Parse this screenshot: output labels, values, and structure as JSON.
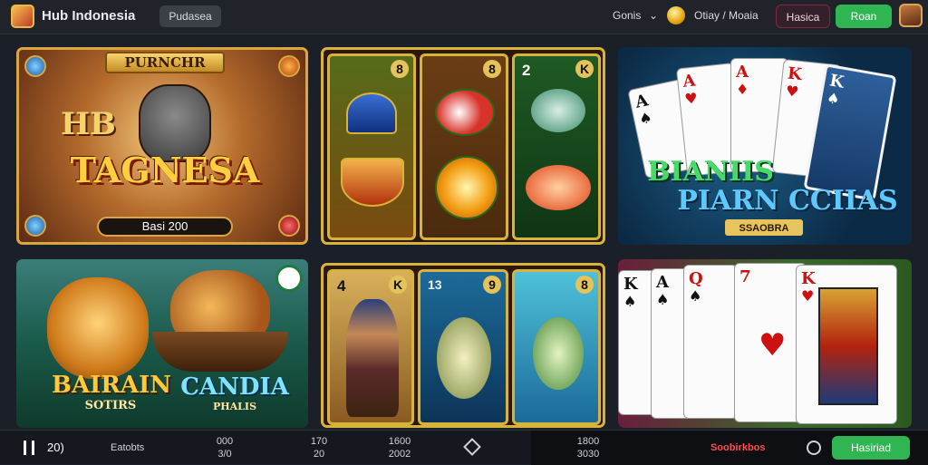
{
  "header": {
    "app_title": "Hub Indonesia",
    "chip_label": "Pudasea",
    "menu_label": "Gonis",
    "menu_chevron": "⌄",
    "user_text": "Otiay / Moaia",
    "secondary_button": "Hasica",
    "primary_button": "Roan",
    "icons": [
      "app-logo-icon",
      "coin-icon",
      "avatar-icon",
      "chevron-down-icon"
    ]
  },
  "tiles": {
    "t1": {
      "banner": "PURNCHR",
      "title_top": "HB",
      "title_main": "TAGNESA",
      "bar_label": "Basi 200"
    },
    "t2": {
      "reel_numbers": [
        "8",
        "8",
        "2",
        "K"
      ]
    },
    "t3": {
      "title_line1": "BIANIIS",
      "title_line2": "PIARN CCIIAS",
      "subtitle": "SSAOBRA",
      "cards": [
        {
          "rank": "A",
          "suit": "♠"
        },
        {
          "rank": "A",
          "suit": "♥"
        },
        {
          "rank": "A",
          "suit": "♦"
        },
        {
          "rank": "K",
          "suit": "♥"
        },
        {
          "rank": "K",
          "suit": "♠"
        }
      ]
    },
    "t4": {
      "title": "BAIRAIN",
      "title_sub": "SOTIRS",
      "title2": "CANDIA",
      "title2_sub": "PHALIS",
      "badge_icon": "clock-icon"
    },
    "t5": {
      "reel_numbers": [
        "4",
        "K",
        "13",
        "9",
        "8"
      ]
    },
    "t6": {
      "cards": [
        {
          "rank": "K",
          "suit": "♠"
        },
        {
          "rank": "A",
          "suit": "♠"
        },
        {
          "rank": "Q",
          "suit": "♠"
        },
        {
          "rank": "7",
          "suit": "♥"
        },
        {
          "rank": "K",
          "suit": "♥"
        }
      ]
    }
  },
  "footer": {
    "pause_icon": "pause-icon",
    "left_value": "20)",
    "label": "Eatobts",
    "stat1_top": "000",
    "stat1_bottom": "3/0",
    "stat2_top": "170",
    "stat2_bottom": "20",
    "stat3_top": "1600",
    "stat3_bottom": "2002",
    "diamond_icon": "diamond-icon",
    "stat4_top": "1800",
    "stat4_bottom": "3030",
    "promo": "Soobirkbos",
    "clock_icon": "clock-icon",
    "action_button": "Hasiriad"
  },
  "colors": {
    "accent_green": "#2fb552",
    "gold": "#d8b33a",
    "promo_red": "#ff4d4d"
  }
}
